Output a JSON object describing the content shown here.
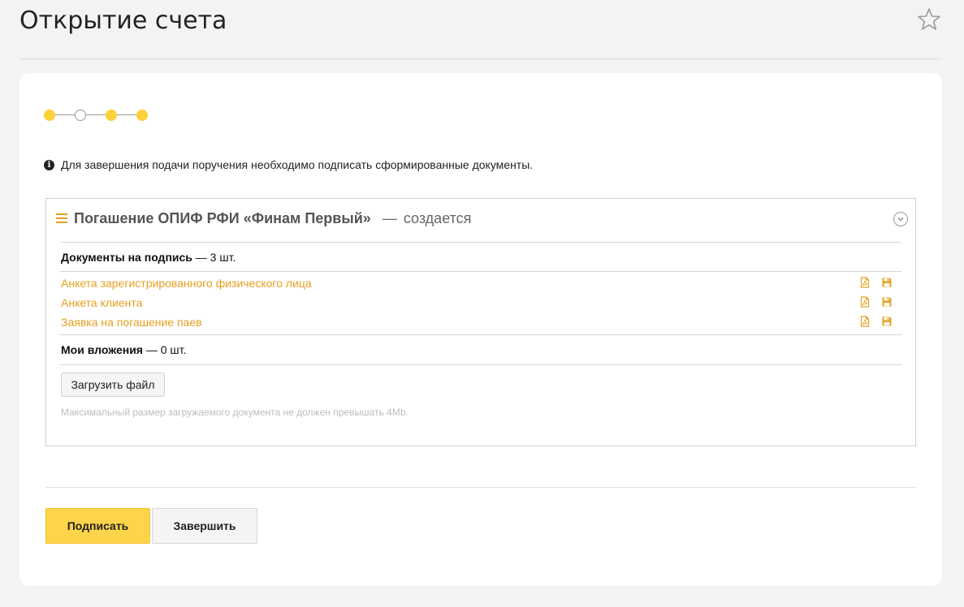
{
  "page": {
    "title": "Открытие счета"
  },
  "stepper": {
    "steps": [
      "filled",
      "empty",
      "filled",
      "filled"
    ],
    "accent_color": "#fdd13b"
  },
  "info": {
    "icon": "info-icon",
    "text": "Для завершения подачи поручения необходимо подписать сформированные документы."
  },
  "panel": {
    "title": "Погашение ОПИФ РФИ «Финам Первый»",
    "dash": "—",
    "status": "создается",
    "documents_label": "Документы на подпись",
    "documents_count": "— 3 шт.",
    "documents": [
      {
        "name": "Анкета зарегистрированного физического лица"
      },
      {
        "name": "Анкета клиента"
      },
      {
        "name": "Заявка на погашение паев"
      }
    ],
    "attachments_label": "Мои вложения",
    "attachments_count": "— 0 шт.",
    "upload_label": "Загрузить файл",
    "hint": "Максимальный размер загружаемого документа не должен превышать 4Mb."
  },
  "actions": {
    "sign_label": "Подписать",
    "finish_label": "Завершить"
  },
  "colors": {
    "link": "#e6a020",
    "primary_button": "#fdd44a"
  }
}
